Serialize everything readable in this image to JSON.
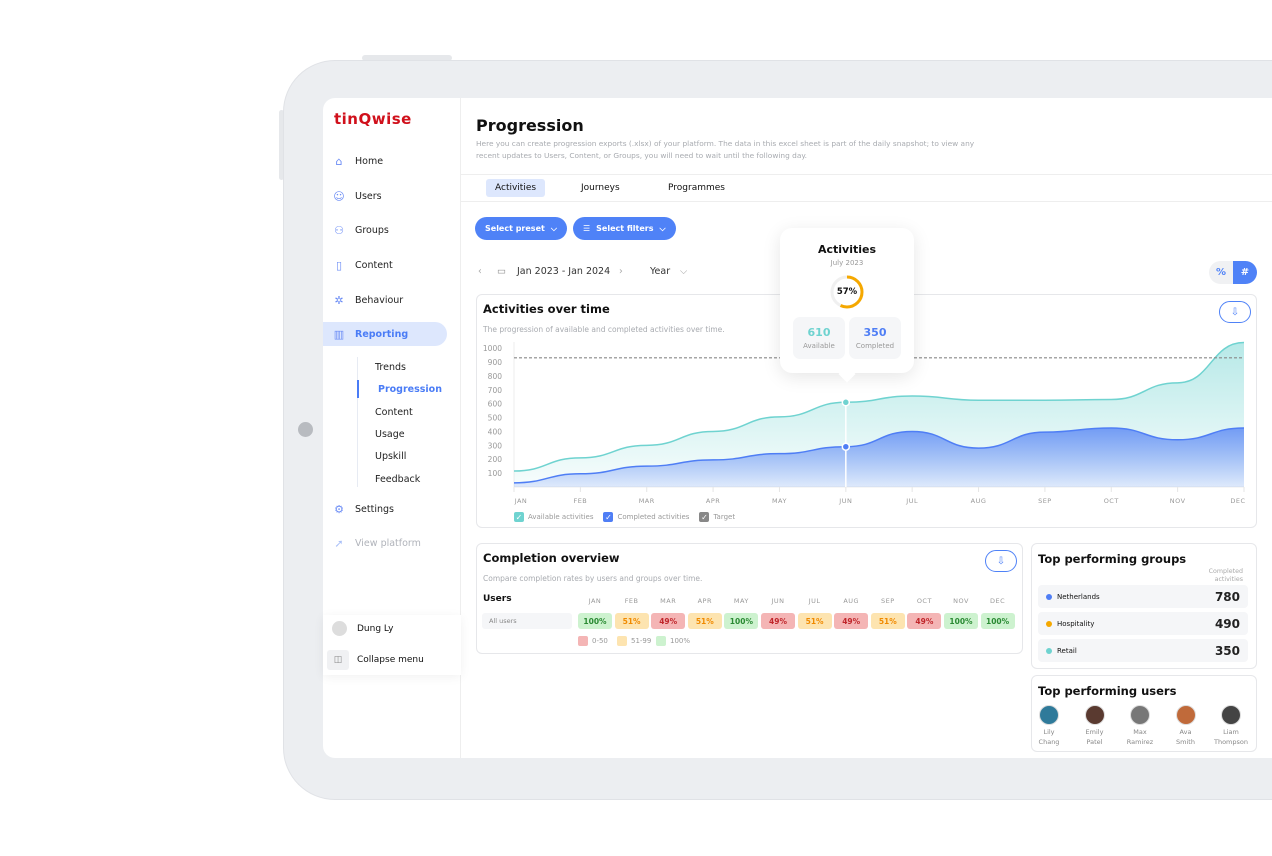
{
  "brand": {
    "logo": "tinQwise",
    "color": "#d0101b"
  },
  "sidebar": {
    "items": [
      {
        "label": "Home",
        "icon": "home-icon",
        "glyph": "⌂"
      },
      {
        "label": "Users",
        "icon": "user-icon",
        "glyph": "☺"
      },
      {
        "label": "Groups",
        "icon": "groups-icon",
        "glyph": "⚇"
      },
      {
        "label": "Content",
        "icon": "content-icon",
        "glyph": "▯"
      },
      {
        "label": "Behaviour",
        "icon": "behaviour-icon",
        "glyph": "✲"
      },
      {
        "label": "Reporting",
        "icon": "bar-chart-icon",
        "glyph": "▥"
      }
    ],
    "sub_items": [
      "Trends",
      "Progression",
      "Content",
      "Usage",
      "Upskill",
      "Feedback"
    ],
    "settings": "Settings",
    "view_platform": "View platform",
    "user": "Dung Ly",
    "collapse": "Collapse menu"
  },
  "header": {
    "title": "Progression",
    "description": "Here you can create progression exports (.xlsx) of your platform. The data in this excel sheet is part of the daily snapshot; to view any recent updates to Users, Content, or Groups, you will need to wait until the following day."
  },
  "tabs": [
    "Activities",
    "Journeys",
    "Programmes"
  ],
  "toolbar": {
    "preset": "Select preset",
    "filters": "Select filters",
    "date_range": "Jan 2023 - Jan 2024",
    "period": "Year",
    "toggle_percent": "%",
    "toggle_number": "#"
  },
  "tooltip": {
    "title": "Activities",
    "month": "July 2023",
    "percent": "57%",
    "percent_value": 57,
    "available": "610",
    "available_label": "Available",
    "completed": "350",
    "completed_label": "Completed"
  },
  "activities_card": {
    "title": "Activities over time",
    "subtitle": "The progression of available and completed activities over time."
  },
  "chart_data": {
    "type": "area",
    "categories": [
      "JAN",
      "FEB",
      "MAR",
      "APR",
      "MAY",
      "JUN",
      "JUL",
      "AUG",
      "SEP",
      "OCT",
      "NOV",
      "DEC"
    ],
    "yticks": [
      100,
      200,
      300,
      400,
      500,
      600,
      700,
      800,
      900,
      1000
    ],
    "ylim": [
      0,
      1000
    ],
    "series": [
      {
        "name": "Available activities",
        "color": "#6fd3d0",
        "values": [
          115,
          210,
          300,
          400,
          505,
          610,
          655,
          625,
          625,
          630,
          750,
          1040
        ]
      },
      {
        "name": "Completed activities",
        "color": "#4f7ef5",
        "values": [
          30,
          95,
          150,
          195,
          240,
          290,
          400,
          280,
          395,
          425,
          340,
          425
        ]
      }
    ],
    "target": {
      "name": "Target",
      "value": 930,
      "color": "#888888"
    },
    "highlight": "JUN",
    "grid": false
  },
  "completion": {
    "title": "Completion overview",
    "subtitle": "Compare completion rates by users and groups over time.",
    "row_header": "Users",
    "row_label": "All users",
    "values": [
      "100%",
      "51%",
      "49%",
      "51%",
      "100%",
      "49%",
      "51%",
      "49%",
      "51%",
      "49%",
      "100%",
      "100%"
    ],
    "legend": [
      {
        "label": "0-50",
        "color": "#f4b5b5"
      },
      {
        "label": "51-99",
        "color": "#fde4b0"
      },
      {
        "label": "100%",
        "color": "#cdf2cf"
      }
    ]
  },
  "groups": {
    "title": "Top performing groups",
    "column": "Completed activities",
    "items": [
      {
        "name": "Netherlands",
        "value": "780",
        "color": "#4f7ef5"
      },
      {
        "name": "Hospitality",
        "value": "490",
        "color": "#f5a800"
      },
      {
        "name": "Retail",
        "value": "350",
        "color": "#6fd3d0"
      }
    ]
  },
  "users": {
    "title": "Top performing users",
    "items": [
      {
        "first": "Lily",
        "last": "Chang",
        "color": "#2f7a9a"
      },
      {
        "first": "Emily",
        "last": "Patel",
        "color": "#5a3a30"
      },
      {
        "first": "Max",
        "last": "Ramirez",
        "color": "#777"
      },
      {
        "first": "Ava",
        "last": "Smith",
        "color": "#c06a3a"
      },
      {
        "first": "Liam",
        "last": "Thompson",
        "color": "#444"
      }
    ]
  }
}
